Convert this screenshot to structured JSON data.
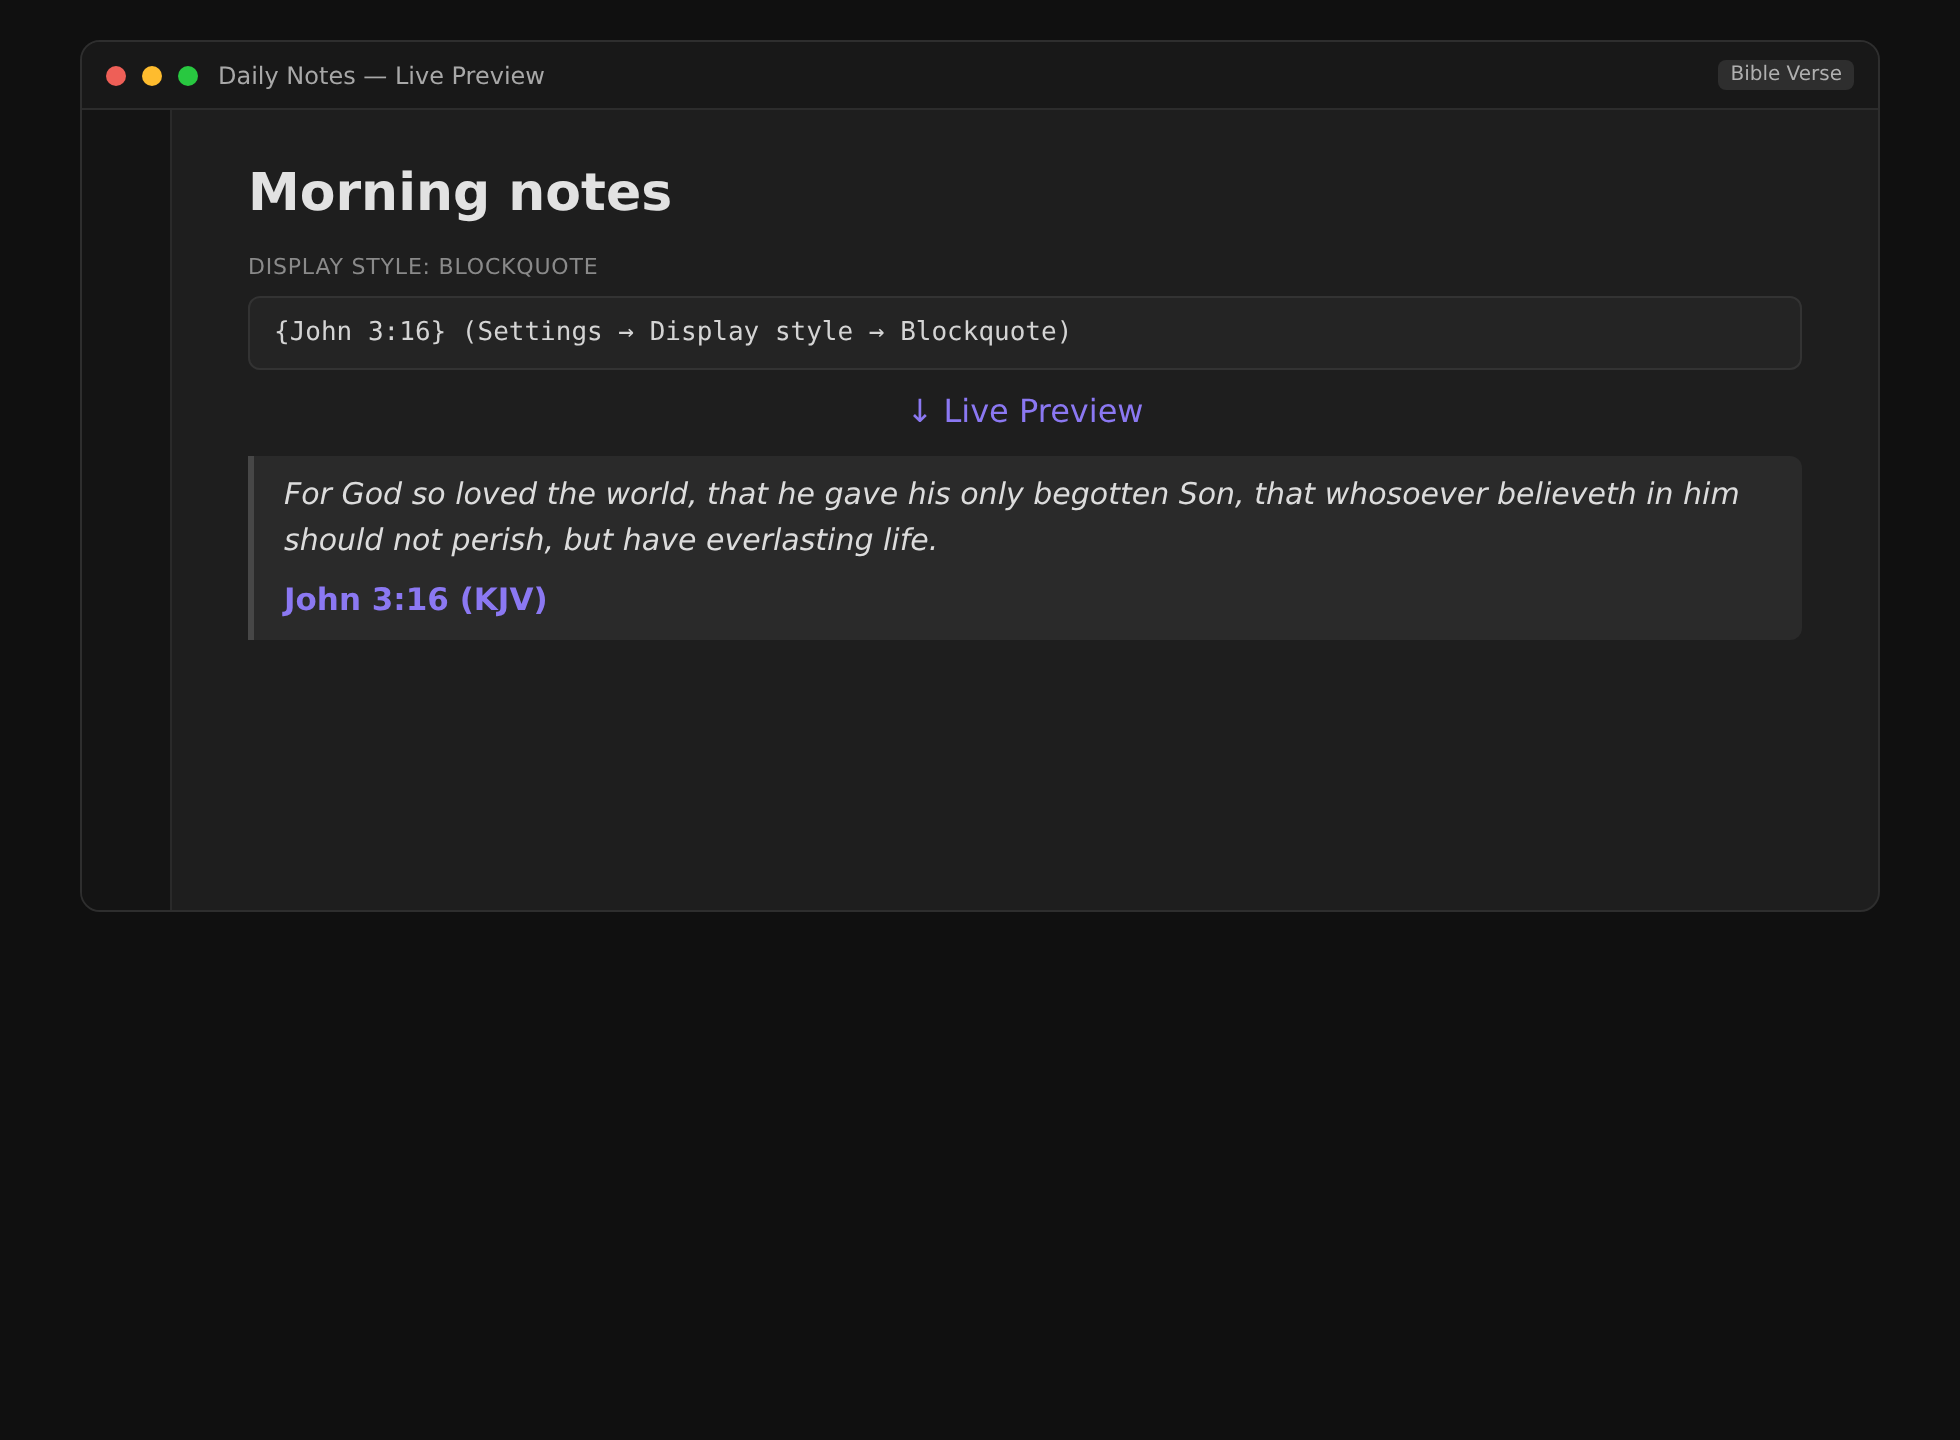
{
  "window": {
    "title": "Daily Notes — Live Preview",
    "badge": "Bible Verse",
    "controls": [
      {
        "color": "#ee5f57"
      },
      {
        "color": "#febc2e"
      },
      {
        "color": "#28c840"
      }
    ]
  },
  "note": {
    "title": "Morning notes",
    "label": "DISPLAY STYLE: BLOCKQUOTE",
    "source": "{John 3:16} (Settings → Display style → Blockquote)",
    "preview_label": "↓ Live Preview",
    "verse": {
      "text": "For God so loved the world, that he gave his only begotten Son, that whosoever believeth in him should not perish, but have everlasting life.",
      "reference": "John 3:16 (KJV)"
    }
  }
}
